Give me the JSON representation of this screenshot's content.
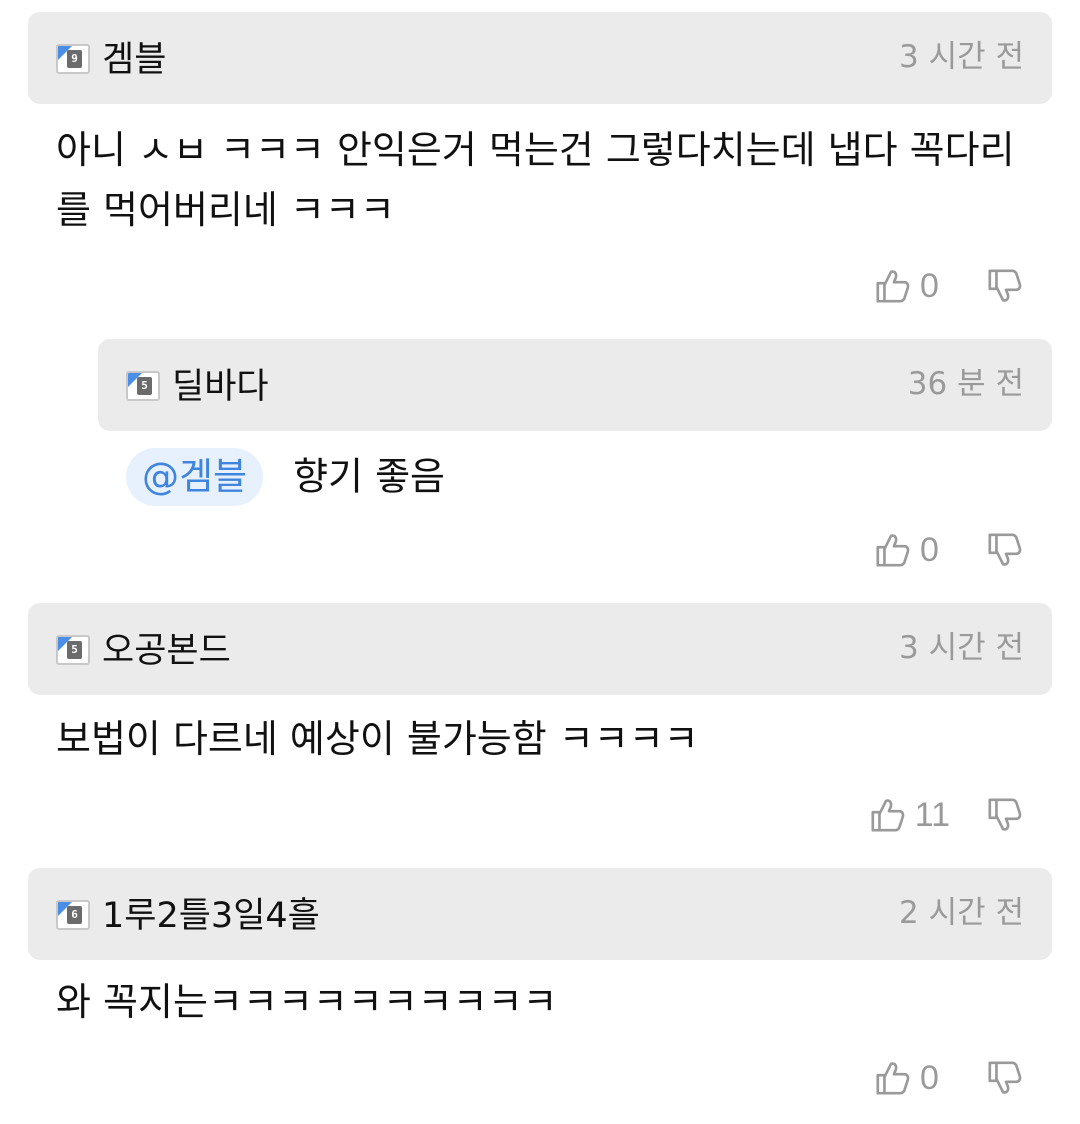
{
  "comments": [
    {
      "level": "9",
      "nickname": "겜블",
      "time": "3 시간 전",
      "text": "아니 ㅅㅂ ㅋㅋㅋ 안익은거 먹는건 그렇다치는데 냅다 꼭다리를 먹어버리네 ㅋㅋㅋ",
      "likes": "0"
    },
    {
      "level": "5",
      "nickname": "딜바다",
      "time": "36 분 전",
      "mention": "@겜블",
      "text": "향기 좋음",
      "likes": "0"
    },
    {
      "level": "5",
      "nickname": "오공본드",
      "time": "3 시간 전",
      "text": "보법이 다르네 예상이 불가능함 ㅋㅋㅋㅋ",
      "likes": "11"
    },
    {
      "level": "6",
      "nickname": "1루2틀3일4흘",
      "time": "2 시간 전",
      "text": "와 꼭지는ㅋㅋㅋㅋㅋㅋㅋㅋㅋㅋ",
      "likes": "0"
    }
  ],
  "icons": {
    "like": "thumbs-up-icon",
    "dislike": "thumbs-down-icon"
  },
  "colors": {
    "header_bg": "#ebebeb",
    "mention_bg": "#e7f1fd",
    "mention_text": "#3f84de",
    "muted": "#9a9a9a"
  }
}
